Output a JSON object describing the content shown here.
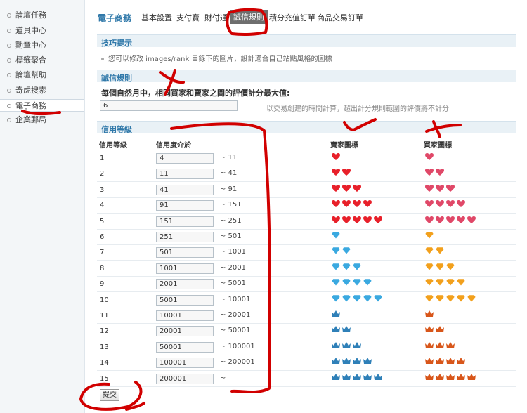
{
  "sidebar": {
    "items": [
      {
        "label": "論壇任務"
      },
      {
        "label": "道具中心"
      },
      {
        "label": "勳章中心"
      },
      {
        "label": "標籤聚合"
      },
      {
        "label": "論壇幫助"
      },
      {
        "label": "奇虎搜索"
      },
      {
        "label": "電子商務",
        "active": true
      },
      {
        "label": "企業郵局"
      }
    ]
  },
  "nav": {
    "brand": "電子商務",
    "tabs": [
      {
        "label": "基本設置"
      },
      {
        "label": "支付寶"
      },
      {
        "label": "財付通"
      },
      {
        "label": "誠信規則",
        "active": true
      },
      {
        "label": "積分充值訂單"
      },
      {
        "label": "商品交易訂單"
      }
    ]
  },
  "tips": {
    "title": "技巧提示",
    "text": "您可以修改 images/rank 目錄下的圖片，設計適合自己站點風格的圖標"
  },
  "credit_rules": {
    "title": "誠信規則",
    "field_label": "每個自然月中，相同買家和賣家之間的評價計分最大值:",
    "field_value": "6",
    "hint": "以交易創建的時間計算，超出計分規則範圍的評價將不計分"
  },
  "credit_levels": {
    "title": "信用等級",
    "headers": {
      "level": "信用等級",
      "range": "信用度介於",
      "seller": "賣家圖標",
      "buyer": "買家圖標"
    },
    "rows": [
      {
        "level": "1",
        "min": "4",
        "upper": "~ 11",
        "icon": "heart",
        "count": 1
      },
      {
        "level": "2",
        "min": "11",
        "upper": "~ 41",
        "icon": "heart",
        "count": 2
      },
      {
        "level": "3",
        "min": "41",
        "upper": "~ 91",
        "icon": "heart",
        "count": 3
      },
      {
        "level": "4",
        "min": "91",
        "upper": "~ 151",
        "icon": "heart",
        "count": 4
      },
      {
        "level": "5",
        "min": "151",
        "upper": "~ 251",
        "icon": "heart",
        "count": 5
      },
      {
        "level": "6",
        "min": "251",
        "upper": "~ 501",
        "icon": "diamond",
        "count": 1
      },
      {
        "level": "7",
        "min": "501",
        "upper": "~ 1001",
        "icon": "diamond",
        "count": 2
      },
      {
        "level": "8",
        "min": "1001",
        "upper": "~ 2001",
        "icon": "diamond",
        "count": 3
      },
      {
        "level": "9",
        "min": "2001",
        "upper": "~ 5001",
        "icon": "diamond",
        "count": 4
      },
      {
        "level": "10",
        "min": "5001",
        "upper": "~ 10001",
        "icon": "diamond",
        "count": 5
      },
      {
        "level": "11",
        "min": "10001",
        "upper": "~ 20001",
        "icon": "crown",
        "count": 1
      },
      {
        "level": "12",
        "min": "20001",
        "upper": "~ 50001",
        "icon": "crown",
        "count": 2
      },
      {
        "level": "13",
        "min": "50001",
        "upper": "~ 100001",
        "icon": "crown",
        "count": 3
      },
      {
        "level": "14",
        "min": "100001",
        "upper": "~ 200001",
        "icon": "crown",
        "count": 4
      },
      {
        "level": "15",
        "min": "200001",
        "upper": "~",
        "icon": "crown",
        "count": 5
      }
    ]
  },
  "submit_label": "提交",
  "colors": {
    "accent": "#2f78a9",
    "seller_heart": "#e8202a",
    "buyer_heart": "#e04868",
    "seller_diamond": "#3aa9e0",
    "buyer_diamond": "#f2a01c",
    "seller_crown": "#2f80b8",
    "buyer_crown": "#d8561a",
    "annotation": "#d10000"
  }
}
